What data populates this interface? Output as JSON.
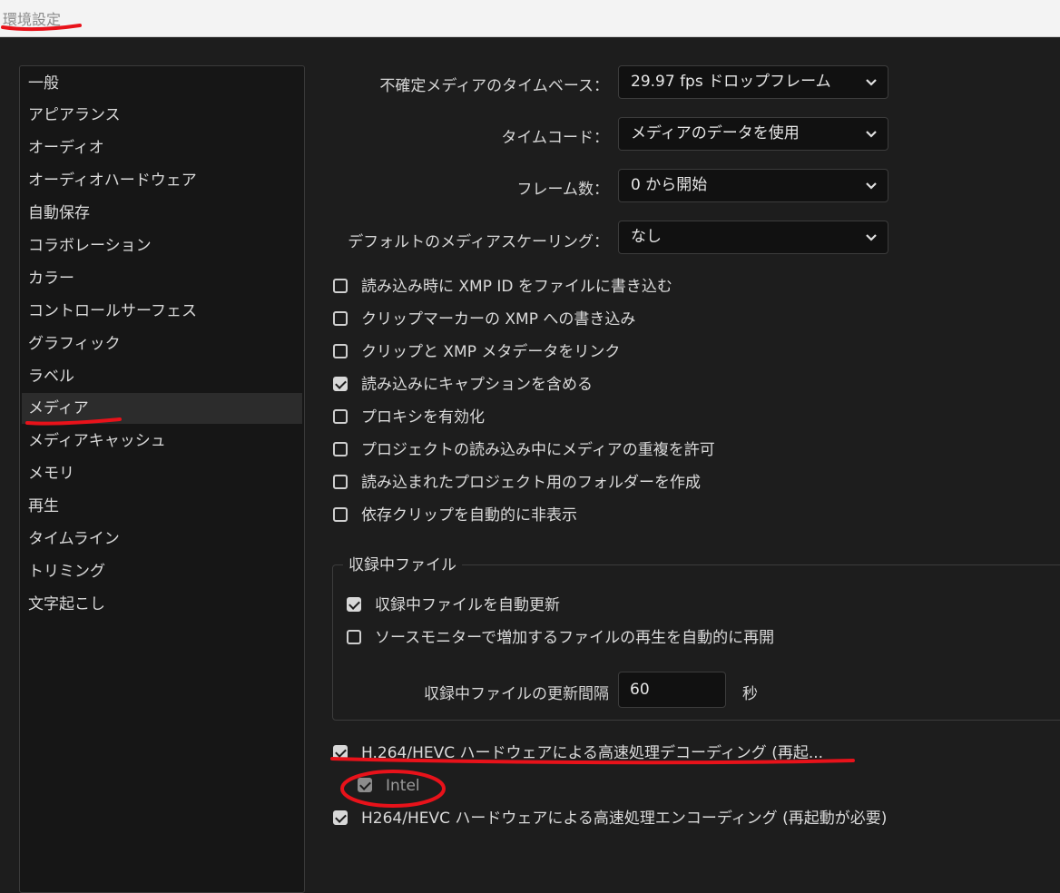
{
  "window": {
    "title": "環境設定"
  },
  "sidebar": {
    "items": [
      {
        "label": "一般"
      },
      {
        "label": "アピアランス"
      },
      {
        "label": "オーディオ"
      },
      {
        "label": "オーディオハードウェア"
      },
      {
        "label": "自動保存"
      },
      {
        "label": "コラボレーション"
      },
      {
        "label": "カラー"
      },
      {
        "label": "コントロールサーフェス"
      },
      {
        "label": "グラフィック"
      },
      {
        "label": "ラベル"
      },
      {
        "label": "メディア",
        "selected": true
      },
      {
        "label": "メディアキャッシュ"
      },
      {
        "label": "メモリ"
      },
      {
        "label": "再生"
      },
      {
        "label": "タイムライン"
      },
      {
        "label": "トリミング"
      },
      {
        "label": "文字起こし"
      }
    ]
  },
  "fields": {
    "timebase": {
      "label": "不確定メディアのタイムベース：",
      "value": "29.97 fps ドロップフレーム"
    },
    "timecode": {
      "label": "タイムコード：",
      "value": "メディアのデータを使用"
    },
    "frame_count": {
      "label": "フレーム数：",
      "value": "0 から開始"
    },
    "scaling": {
      "label": "デフォルトのメディアスケーリング：",
      "value": "なし"
    }
  },
  "checkboxes": [
    {
      "label": "読み込み時に XMP ID をファイルに書き込む",
      "checked": false
    },
    {
      "label": "クリップマーカーの XMP への書き込み",
      "checked": false
    },
    {
      "label": "クリップと XMP メタデータをリンク",
      "checked": false
    },
    {
      "label": "読み込みにキャプションを含める",
      "checked": true
    },
    {
      "label": "プロキシを有効化",
      "checked": false
    },
    {
      "label": "プロジェクトの読み込み中にメディアの重複を許可",
      "checked": false
    },
    {
      "label": "読み込まれたプロジェクト用のフォルダーを作成",
      "checked": false
    },
    {
      "label": "依存クリップを自動的に非表示",
      "checked": false
    }
  ],
  "growing_files": {
    "title": "収録中ファイル",
    "auto_refresh": {
      "label": "収録中ファイルを自動更新",
      "checked": true
    },
    "auto_resume": {
      "label": "ソースモニターで増加するファイルの再生を自動的に再開",
      "checked": false
    },
    "interval": {
      "label": "収録中ファイルの更新間隔",
      "value": "60",
      "unit": "秒"
    }
  },
  "hardware": {
    "decoding": {
      "label": "H.264/HEVC ハードウェアによる高速処理デコーディング (再起...",
      "checked": true
    },
    "intel": {
      "label": "Intel",
      "checked": true,
      "disabled": true
    },
    "encoding": {
      "label": "H264/HEVC ハードウェアによる高速処理エンコーディング (再起動が必要)",
      "checked": true
    }
  },
  "colors": {
    "annotation": "#e8121a",
    "background": "#1d1d1d"
  }
}
